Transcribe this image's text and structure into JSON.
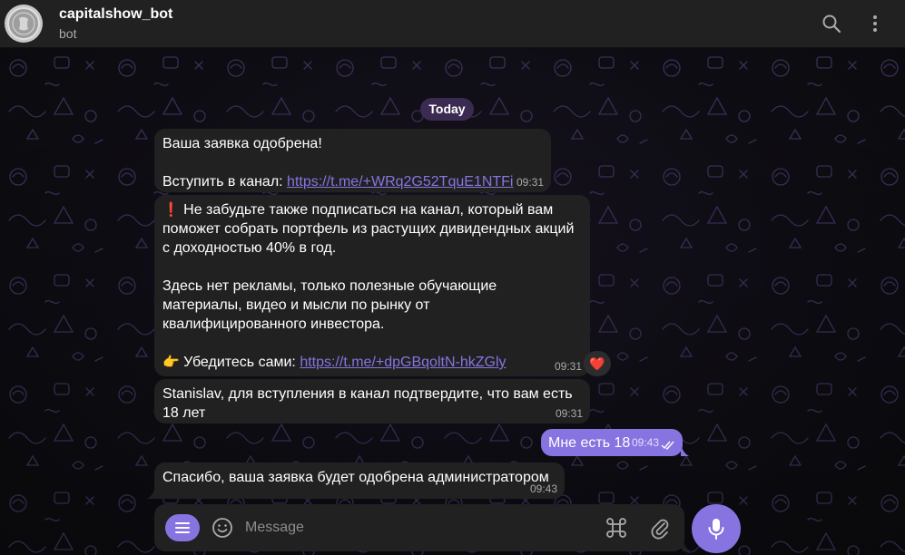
{
  "header": {
    "title": "capitalshow_bot",
    "subtitle": "bot",
    "avatar_icon": "coin-avatar",
    "search_icon": "search-icon",
    "more_icon": "more-vertical-icon"
  },
  "chat": {
    "date_label": "Today",
    "messages": [
      {
        "line1": "Ваша заявка одобрена!",
        "line2_prefix": "Вступить в канал: ",
        "link": "https://t.me/+WRq2G52TquE1NTFi",
        "time": "09:31"
      },
      {
        "emoji1": "❗",
        "p1_l1": " Не забудьте также подписаться на канал, который вам",
        "p1_l2": "поможет собрать портфель из растущих дивидендных акций",
        "p1_l3": "с доходностью 40% в год.",
        "p2_l1": "Здесь нет рекламы, только полезные обучающие",
        "p2_l2": "материалы, видео и мысли по рынку от",
        "p2_l3": "квалифицированного инвестора.",
        "emoji2": "👉",
        "p3_prefix": " Убедитесь сами: ",
        "link": "https://t.me/+dpGBqoltN-hkZGly",
        "time": "09:31",
        "reaction": "❤️"
      },
      {
        "l1": "Stanislav, для вступления в канал подтвердите, что вам есть",
        "l2": "18 лет",
        "time": "09:31"
      },
      {
        "text": "Мне есть 18",
        "time": "09:43",
        "status_icon": "double-check-icon"
      },
      {
        "text": "Спасибо, ваша заявка будет одобрена администратором",
        "time": "09:43"
      }
    ]
  },
  "composer": {
    "placeholder": "Message",
    "menu_icon": "menu-icon",
    "emoji_icon": "emoji-icon",
    "commands_icon": "command-icon",
    "attach_icon": "paperclip-icon",
    "mic_icon": "microphone-icon"
  },
  "colors": {
    "accent": "#8774e1",
    "bubble_in": "#212121",
    "header_bg": "#212121",
    "date_pill": "#3b2b52"
  }
}
